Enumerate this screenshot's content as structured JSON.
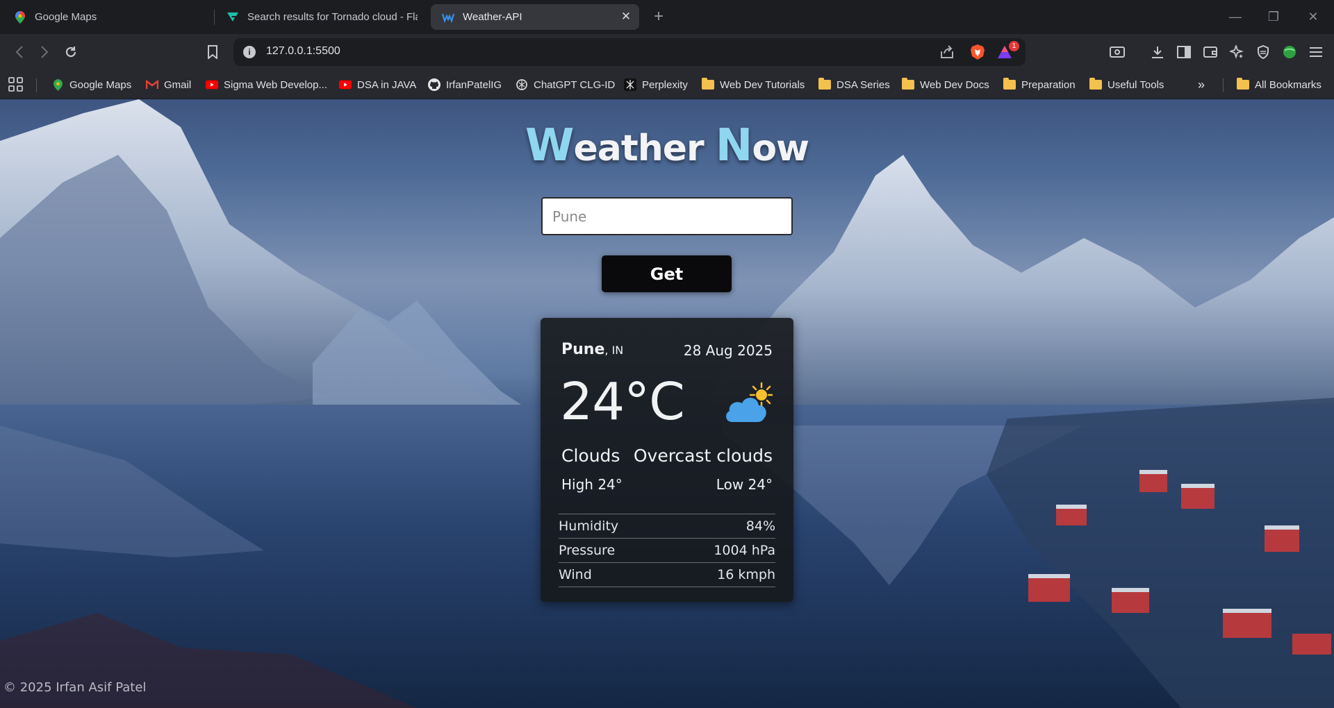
{
  "browser": {
    "tabs": [
      {
        "title": "Google Maps",
        "active": false,
        "icon": "google-maps-icon"
      },
      {
        "title": "Search results for Tornado cloud - Fla",
        "active": false,
        "icon": "flaticon-icon"
      },
      {
        "title": "Weather-API",
        "active": true,
        "icon": "weather-api-icon"
      }
    ],
    "address": "127.0.0.1:5500",
    "rewards_badge": "1",
    "bookmarks": [
      {
        "label": "Google Maps",
        "icon": "google-maps-icon"
      },
      {
        "label": "Gmail",
        "icon": "gmail-icon"
      },
      {
        "label": "Sigma Web Develop...",
        "icon": "youtube-icon"
      },
      {
        "label": "DSA in JAVA",
        "icon": "youtube-icon"
      },
      {
        "label": "IrfanPatelIG",
        "icon": "github-icon"
      },
      {
        "label": "ChatGPT CLG-ID",
        "icon": "chatgpt-icon"
      },
      {
        "label": "Perplexity",
        "icon": "perplexity-icon"
      },
      {
        "label": "Web Dev Tutorials",
        "icon": "folder-icon"
      },
      {
        "label": "DSA Series",
        "icon": "folder-icon"
      },
      {
        "label": "Web Dev Docs",
        "icon": "folder-icon"
      },
      {
        "label": "Preparation",
        "icon": "folder-icon"
      },
      {
        "label": "Useful Tools",
        "icon": "folder-icon"
      }
    ],
    "all_bookmarks": "All Bookmarks"
  },
  "page": {
    "title_first_initial": "W",
    "title_first_rest": "eather ",
    "title_second_initial": "N",
    "title_second_rest": "ow",
    "search_value": "Pune",
    "get_label": "Get",
    "footer": "© 2025 Irfan Asif Patel"
  },
  "weather": {
    "city": "Pune",
    "country": ", IN",
    "date": "28 Aug 2025",
    "temp": "24°C",
    "main": "Clouds",
    "description": "Overcast clouds",
    "high": "High 24°",
    "low": "Low 24°",
    "icon": "partly-cloudy-icon",
    "details": [
      {
        "label": "Humidity",
        "value": "84%"
      },
      {
        "label": "Pressure",
        "value": "1004 hPa"
      },
      {
        "label": "Wind",
        "value": "16 kmph"
      }
    ]
  },
  "colors": {
    "accent": "#8fd6ef",
    "card_bg": "#16181c",
    "button_bg": "#0a0a0c"
  }
}
